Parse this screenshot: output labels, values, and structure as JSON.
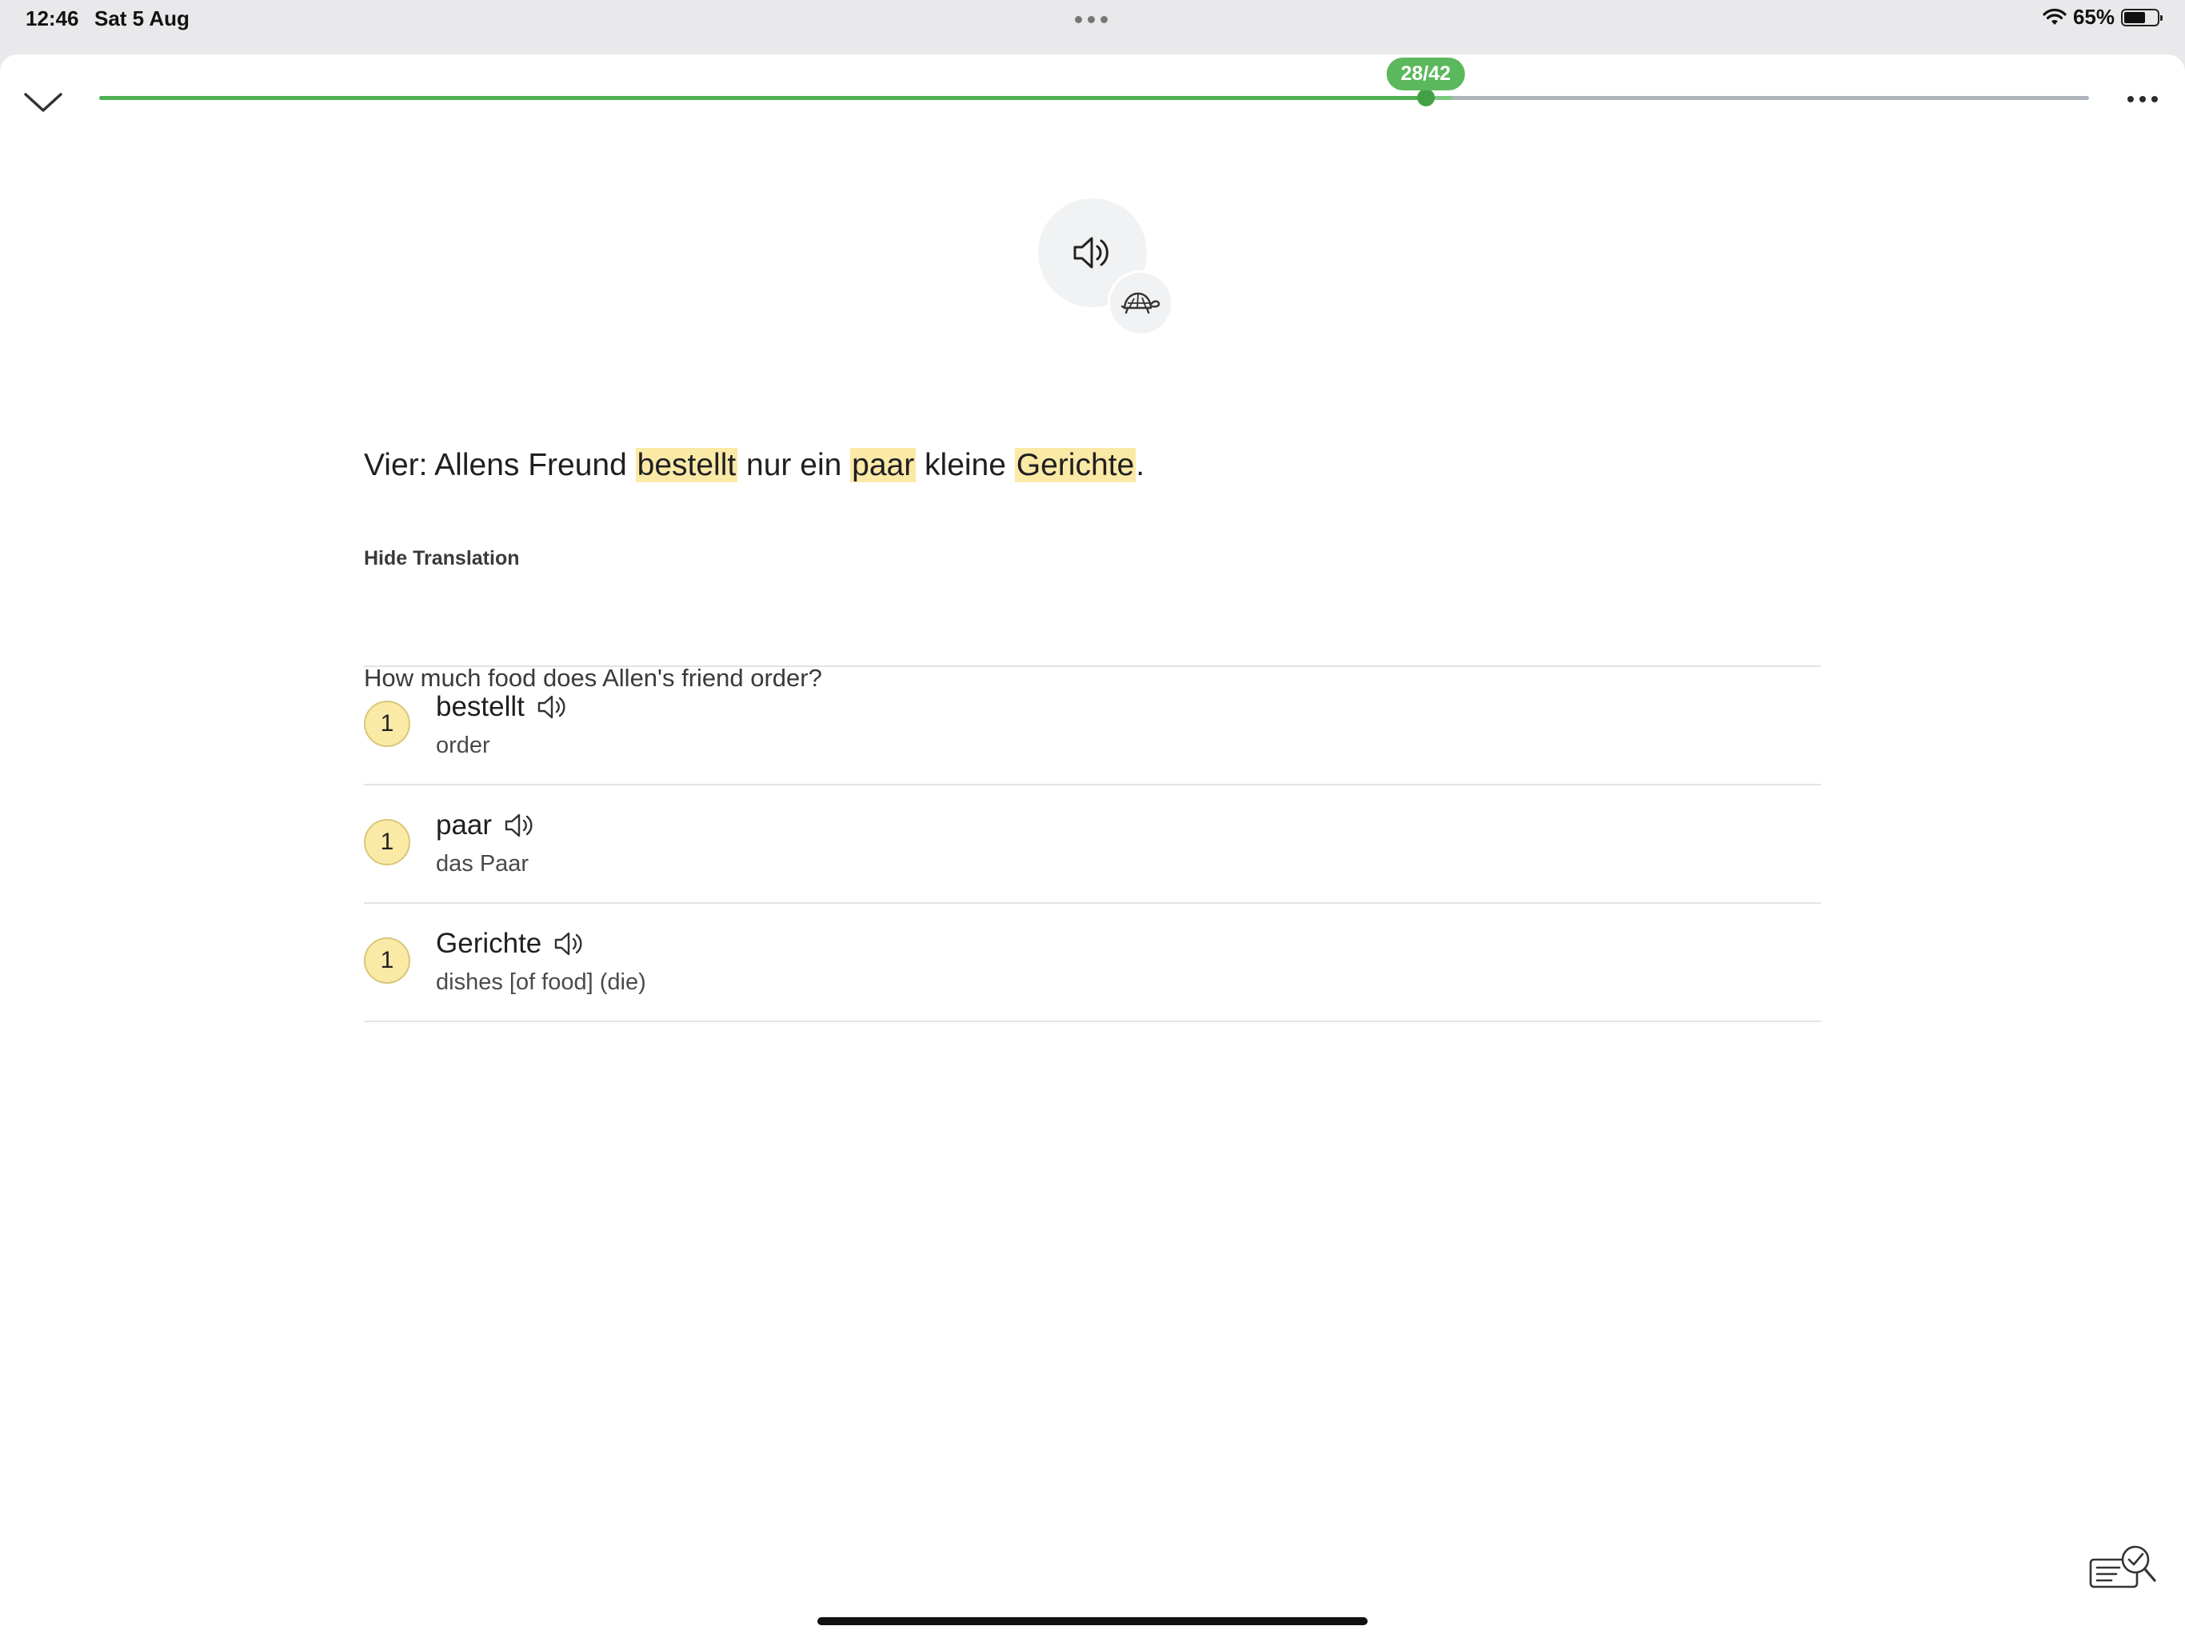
{
  "status_bar": {
    "time": "12:46",
    "date": "Sat 5 Aug",
    "battery_percent": "65%",
    "battery_level": 0.65
  },
  "progress": {
    "label": "28/42",
    "current": 28,
    "total": 42,
    "buffered": 0.68,
    "fill_color": "#4caf50"
  },
  "audio": {
    "play_icon": "speaker-icon",
    "slow_icon": "turtle-icon"
  },
  "sentence": {
    "segments": [
      {
        "text": "Vier: Allens Freund ",
        "highlight": false
      },
      {
        "text": "bestellt",
        "highlight": true
      },
      {
        "text": " nur ein ",
        "highlight": false
      },
      {
        "text": "paar",
        "highlight": true
      },
      {
        "text": " kleine ",
        "highlight": false
      },
      {
        "text": "Gerichte",
        "highlight": true
      },
      {
        "text": ".",
        "highlight": false
      }
    ],
    "highlight_color": "#fbe9a6"
  },
  "translation": {
    "toggle_label": "Hide Translation",
    "text": "How much food does Allen's friend order?"
  },
  "words": [
    {
      "count": "1",
      "term": "bestellt",
      "definition": "order"
    },
    {
      "count": "1",
      "term": "paar",
      "definition": "das Paar"
    },
    {
      "count": "1",
      "term": "Gerichte",
      "definition": "dishes [of food] (die)"
    }
  ]
}
